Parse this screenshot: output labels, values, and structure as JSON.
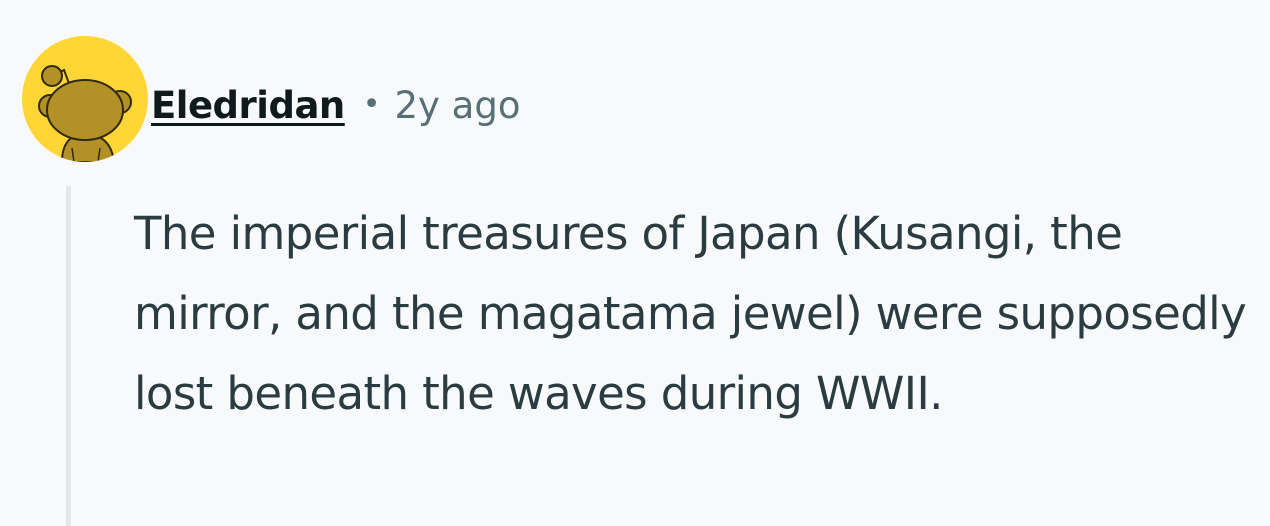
{
  "comment": {
    "author": "Eledridan",
    "separator": "•",
    "timestamp": "2y ago",
    "body": "The imperial treasures of Japan (Kusangi, the mirror, and the magatama jewel) were supposedly lost beneath the waves during WWII.",
    "avatar": {
      "icon": "snoo-avatar-icon",
      "background_color": "#ffd635",
      "figure_color": "#b39126"
    }
  },
  "colors": {
    "page_background": "#f7f9fa",
    "author_text": "#0f1a1c",
    "meta_text": "#576f76",
    "body_text": "#2a3c42",
    "thread_line": "#e2e7e9"
  }
}
